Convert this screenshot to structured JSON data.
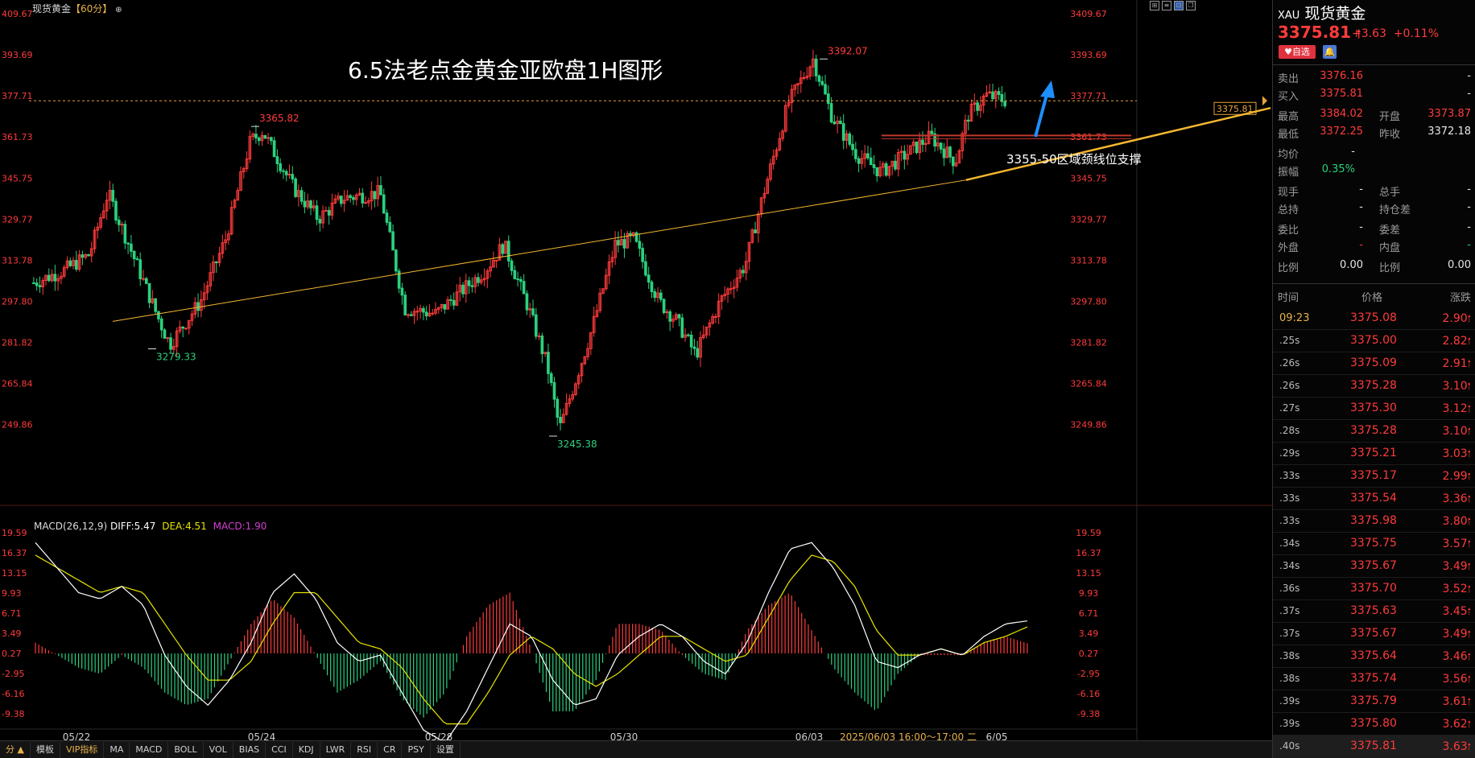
{
  "window": {
    "title": "现货黄金",
    "period": "【60分】",
    "title_icon": "target-icon"
  },
  "overlay": {
    "title": "6.5法老点金黄金亚欧盘1H图形",
    "support_text": "3355-50区域颈线位支撑"
  },
  "colors": {
    "up": "#ff3b3b",
    "down": "#2bd17e",
    "trendline": "#f5b730",
    "arrow": "#1e8fff",
    "dif": "#ffffff",
    "dea": "#e8e500",
    "macd_label": "#d23fd2"
  },
  "macd_header": {
    "name": "MACD(26,12,9)",
    "dif": "DIFF:5.47",
    "dea": "DEA:4.51",
    "macd": "MACD:1.90"
  },
  "chart_data": [
    {
      "type": "candlestick",
      "title": "现货黄金【60分】",
      "y_ticks": [
        "409.67",
        "393.69",
        "377.71",
        "361.73",
        "345.75",
        "329.77",
        "313.78",
        "297.80",
        "281.82",
        "265.84",
        "249.86"
      ],
      "right_ticks": [
        "3409.67",
        "3393.69",
        "3377.71",
        "3361.73",
        "3345.75",
        "3329.77",
        "3313.78",
        "3297.80",
        "3281.82",
        "3265.84",
        "3249.86"
      ],
      "ylim": [
        3246,
        3410
      ],
      "x_labels": [
        "05/22",
        "05/24",
        "05/28",
        "05/30",
        "06/03",
        "2025/06/03 16:00～17:00 二",
        "6/05"
      ],
      "annotations": [
        {
          "label": "3365.82",
          "value": 3365.82,
          "kind": "high"
        },
        {
          "label": "3279.33",
          "value": 3279.33,
          "kind": "low"
        },
        {
          "label": "3245.38",
          "value": 3245.38,
          "kind": "low"
        },
        {
          "label": "3392.07",
          "value": 3392.07,
          "kind": "high"
        }
      ],
      "current_price_label": "3375.81",
      "current_price": 3375.81,
      "path_keypoints": [
        {
          "t": 0,
          "v": 3305
        },
        {
          "t": 10,
          "v": 3310
        },
        {
          "t": 18,
          "v": 3316
        },
        {
          "t": 24,
          "v": 3340
        },
        {
          "t": 30,
          "v": 3322
        },
        {
          "t": 40,
          "v": 3292
        },
        {
          "t": 44,
          "v": 3281
        },
        {
          "t": 54,
          "v": 3298
        },
        {
          "t": 62,
          "v": 3322
        },
        {
          "t": 70,
          "v": 3360
        },
        {
          "t": 74,
          "v": 3364
        },
        {
          "t": 84,
          "v": 3342
        },
        {
          "t": 92,
          "v": 3330
        },
        {
          "t": 100,
          "v": 3338
        },
        {
          "t": 112,
          "v": 3340
        },
        {
          "t": 120,
          "v": 3295
        },
        {
          "t": 130,
          "v": 3293
        },
        {
          "t": 146,
          "v": 3310
        },
        {
          "t": 152,
          "v": 3320
        },
        {
          "t": 160,
          "v": 3295
        },
        {
          "t": 166,
          "v": 3273
        },
        {
          "t": 170,
          "v": 3248
        },
        {
          "t": 180,
          "v": 3285
        },
        {
          "t": 188,
          "v": 3320
        },
        {
          "t": 194,
          "v": 3322
        },
        {
          "t": 202,
          "v": 3298
        },
        {
          "t": 208,
          "v": 3290
        },
        {
          "t": 214,
          "v": 3277
        },
        {
          "t": 222,
          "v": 3298
        },
        {
          "t": 230,
          "v": 3312
        },
        {
          "t": 236,
          "v": 3340
        },
        {
          "t": 244,
          "v": 3375
        },
        {
          "t": 252,
          "v": 3392
        },
        {
          "t": 258,
          "v": 3370
        },
        {
          "t": 266,
          "v": 3355
        },
        {
          "t": 274,
          "v": 3348
        },
        {
          "t": 282,
          "v": 3355
        },
        {
          "t": 290,
          "v": 3362
        },
        {
          "t": 298,
          "v": 3352
        },
        {
          "t": 302,
          "v": 3370
        },
        {
          "t": 308,
          "v": 3378
        },
        {
          "t": 314,
          "v": 3376
        }
      ],
      "trendline": {
        "from": [
          3291,
          0.25
        ],
        "to": [
          3374,
          1.0
        ]
      },
      "support_zone": 3362
    },
    {
      "type": "bar",
      "title": "MACD(26,12,9)",
      "y_ticks": [
        "19.59",
        "16.37",
        "13.15",
        "9.93",
        "6.71",
        "3.49",
        "0.27",
        "-2.95",
        "-6.16",
        "-9.38"
      ],
      "ylim": [
        -12.6,
        19.59
      ],
      "series": [
        {
          "name": "DIFF",
          "values": [
            18,
            14,
            10,
            9,
            11,
            8,
            0,
            -5,
            -8,
            -4,
            2,
            10,
            13,
            9,
            2,
            -1,
            0,
            -6,
            -12,
            -14,
            -9,
            -2,
            5,
            3,
            -4,
            -8,
            -7,
            0,
            3,
            5,
            3,
            -1,
            -3,
            2,
            10,
            17,
            18,
            14,
            8,
            -1,
            -2,
            0,
            1,
            0,
            3,
            5,
            5.47
          ]
        },
        {
          "name": "DEA",
          "values": [
            16,
            14,
            12,
            10,
            11,
            10,
            5,
            0,
            -4,
            -4,
            -1,
            5,
            10,
            10,
            6,
            2,
            1,
            -2,
            -7,
            -11,
            -11,
            -6,
            0,
            3,
            1,
            -3,
            -5,
            -3,
            0,
            3,
            3,
            1,
            -1,
            0,
            6,
            12,
            16,
            15,
            11,
            4,
            0,
            0,
            1,
            0,
            2,
            3,
            4.51
          ]
        },
        {
          "name": "MACD",
          "values": [
            2,
            0,
            -2,
            -3,
            0,
            -2,
            -6,
            -8,
            -7,
            -1,
            5,
            9,
            6,
            0,
            -6,
            -4,
            -1,
            -7,
            -10,
            -6,
            3,
            8,
            10,
            1,
            -9,
            -9,
            -4,
            5,
            5,
            4,
            0,
            -3,
            -4,
            4,
            8,
            10,
            4,
            -2,
            -6,
            -9,
            -3,
            0,
            0,
            0,
            2,
            3,
            1.9
          ]
        }
      ]
    }
  ],
  "bottom_tabs": {
    "arrow": "分 ▲",
    "items": [
      "模板",
      "VIP指标",
      "MA",
      "MACD",
      "BOLL",
      "VOL",
      "BIAS",
      "CCI",
      "KDJ",
      "LWR",
      "RSI",
      "CR",
      "PSY",
      "设置"
    ]
  },
  "quote": {
    "symbol": "XAU",
    "name": "现货黄金",
    "price": "3375.81",
    "change": "+3.63",
    "change_pct": "+0.11%",
    "watch_label": "自选",
    "sell_label": "卖出",
    "sell": "3376.16",
    "sell_vol": "-",
    "buy_label": "买入",
    "buy": "3375.81",
    "buy_vol": "-",
    "high_label": "最高",
    "high": "3384.02",
    "open_label": "开盘",
    "open": "3373.87",
    "low_label": "最低",
    "low": "3372.25",
    "prev_label": "昨收",
    "prev": "3372.18",
    "avg_label": "均价",
    "avg": "-",
    "amp_label": "振幅",
    "amp": "0.35%",
    "cur_hand_label": "现手",
    "cur_hand": "-",
    "total_hand_label": "总手",
    "total_hand": "-",
    "total_hold_label": "总持",
    "total_hold": "-",
    "hold_diff_label": "持仓差",
    "hold_diff": "-",
    "weibi_label": "委比",
    "weibi": "-",
    "weicha_label": "委差",
    "weicha": "-",
    "outer_label": "外盘",
    "outer": "-",
    "inner_label": "内盘",
    "inner": "-",
    "ratio_label": "比例",
    "ratio": "0.00",
    "ratio2_label": "比例",
    "ratio2": "0.00",
    "col_time": "时间",
    "col_price": "价格",
    "col_change": "涨跌"
  },
  "trades": [
    {
      "time": "09:23",
      "price": "3375.08",
      "change": "2.90"
    },
    {
      "time": ".25s",
      "price": "3375.00",
      "change": "2.82"
    },
    {
      "time": ".26s",
      "price": "3375.09",
      "change": "2.91"
    },
    {
      "time": ".26s",
      "price": "3375.28",
      "change": "3.10"
    },
    {
      "time": ".27s",
      "price": "3375.30",
      "change": "3.12"
    },
    {
      "time": ".28s",
      "price": "3375.28",
      "change": "3.10"
    },
    {
      "time": ".29s",
      "price": "3375.21",
      "change": "3.03"
    },
    {
      "time": ".33s",
      "price": "3375.17",
      "change": "2.99"
    },
    {
      "time": ".33s",
      "price": "3375.54",
      "change": "3.36"
    },
    {
      "time": ".33s",
      "price": "3375.98",
      "change": "3.80"
    },
    {
      "time": ".34s",
      "price": "3375.75",
      "change": "3.57"
    },
    {
      "time": ".34s",
      "price": "3375.67",
      "change": "3.49"
    },
    {
      "time": ".36s",
      "price": "3375.70",
      "change": "3.52"
    },
    {
      "time": ".37s",
      "price": "3375.63",
      "change": "3.45"
    },
    {
      "time": ".37s",
      "price": "3375.67",
      "change": "3.49"
    },
    {
      "time": ".38s",
      "price": "3375.64",
      "change": "3.46"
    },
    {
      "time": ".38s",
      "price": "3375.74",
      "change": "3.56"
    },
    {
      "time": ".39s",
      "price": "3375.79",
      "change": "3.61"
    },
    {
      "time": ".39s",
      "price": "3375.80",
      "change": "3.62"
    },
    {
      "time": ".40s",
      "price": "3375.81",
      "change": "3.63"
    }
  ]
}
